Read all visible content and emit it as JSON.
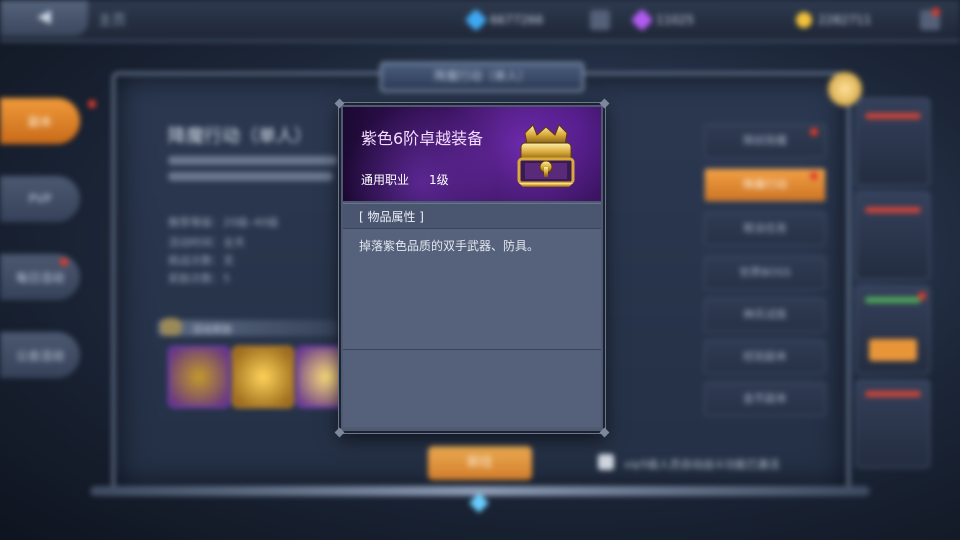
{
  "topbar": {
    "back_icon": "arrow-left-icon",
    "home_label": "主页",
    "resources": [
      {
        "icon": "diamond-icon",
        "color": "#3fa9f5",
        "value": "6677266"
      },
      {
        "icon": "purple-crystal-icon",
        "color": "#b25bf0",
        "value": "11025"
      },
      {
        "icon": "gold-coin-icon",
        "color": "#f3c23a",
        "value": "2282711"
      }
    ]
  },
  "sidebar": {
    "tabs": [
      {
        "label": "副本",
        "active": true,
        "badge": true
      },
      {
        "label": "PVP",
        "active": false,
        "badge": false
      },
      {
        "label": "每日活动",
        "active": false,
        "badge": true
      },
      {
        "label": "公会活动",
        "active": false,
        "badge": false
      }
    ]
  },
  "dungeon": {
    "banner": "降魔行动（单人）",
    "title": "降魔行动（单人）",
    "info_rows": [
      "推荐等级：20级–40级",
      "活动时间：全天",
      "挑战次数：无",
      "奖励次数：5"
    ],
    "rewards_label": "活动奖励",
    "start_button": "前往",
    "auto_label": "vip5级人员自动战斗功能已激活"
  },
  "right_list": [
    {
      "label": "降妖除魔",
      "active": false,
      "badge": true
    },
    {
      "label": "降魔行动",
      "active": true,
      "badge": true
    },
    {
      "label": "帮派任务",
      "active": false,
      "badge": false
    },
    {
      "label": "世界BOSS",
      "active": false,
      "badge": false
    },
    {
      "label": "神兵试炼",
      "active": false,
      "badge": false
    },
    {
      "label": "经验副本",
      "active": false,
      "badge": false
    },
    {
      "label": "金币副本",
      "active": false,
      "badge": false
    }
  ],
  "item_tooltip": {
    "name": "紫色6阶卓越装备",
    "class_label": "通用职业",
    "level": "1级",
    "icon": "treasure-chest-icon",
    "section_title": "[ 物品属性 ]",
    "description": "掉落紫色品质的双手武器、防具。",
    "name_color": "#f4dcff",
    "header_color": "#4a1b7c"
  }
}
